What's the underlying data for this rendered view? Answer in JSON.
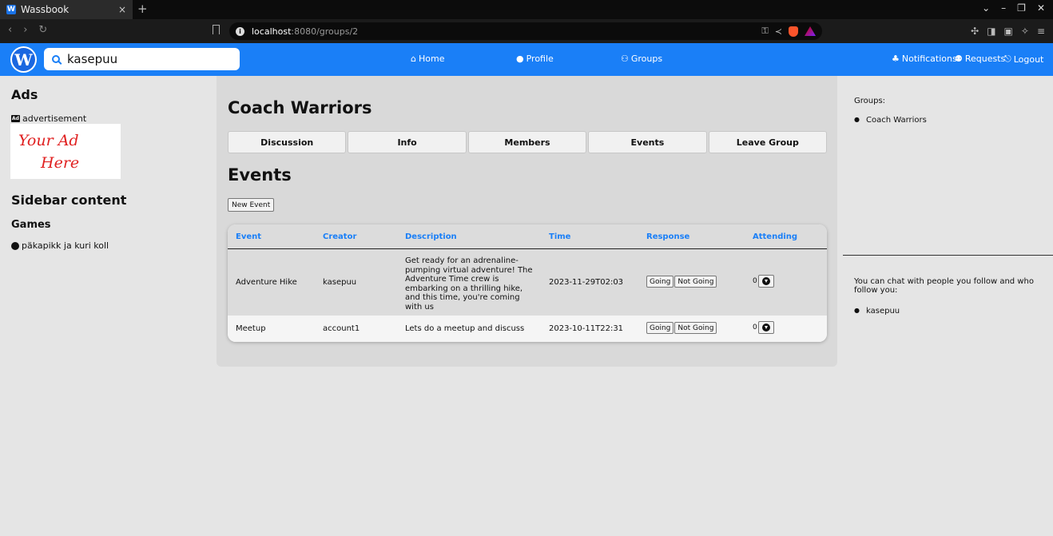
{
  "browser": {
    "tab_title": "Wassbook",
    "favicon": "W",
    "tab_close": "×",
    "new_tab": "+",
    "url_host": "localhost",
    "url_path": ":8080/groups/2",
    "nav_back": "‹",
    "nav_forward": "›",
    "reload": "↻"
  },
  "header": {
    "logo_letter": "W",
    "search_value": "kasepuu",
    "nav": {
      "home": "Home",
      "profile": "Profile",
      "groups": "Groups",
      "notifications": "Notifications",
      "requests": "Requests",
      "logout": "Logout"
    },
    "accent_color": "#1a7ff7"
  },
  "left_sidebar": {
    "ads_title": "Ads",
    "ad_badge": "Ad",
    "ad_label": "advertisement",
    "ad_text_line1": "Your Ad",
    "ad_text_line2": "Here",
    "sidebar_title": "Sidebar content",
    "games_title": "Games",
    "game_item": "päkapikk ja kuri koll"
  },
  "main": {
    "group_name": "Coach Warriors",
    "tabs": [
      {
        "label": "Discussion"
      },
      {
        "label": "Info"
      },
      {
        "label": "Members"
      },
      {
        "label": "Events"
      },
      {
        "label": "Leave Group"
      }
    ],
    "events_title": "Events",
    "new_event_label": "New Event",
    "table": {
      "headers": [
        "Event",
        "Creator",
        "Description",
        "Time",
        "Response",
        "Attending"
      ],
      "rows": [
        {
          "event": "Adventure Hike",
          "creator": "kasepuu",
          "description": "Get ready for an adrenaline-pumping virtual adventure! The Adventure Time crew is embarking on a thrilling hike, and this time, you're coming with us",
          "time": "2023-11-29T02:03",
          "going": "Going",
          "not_going": "Not Going",
          "attending": "0"
        },
        {
          "event": "Meetup",
          "creator": "account1",
          "description": "Lets do a meetup and discuss",
          "time": "2023-10-11T22:31",
          "going": "Going",
          "not_going": "Not Going",
          "attending": "0"
        }
      ]
    }
  },
  "right_sidebar": {
    "groups_label": "Groups:",
    "groups": [
      "Coach Warriors"
    ],
    "chat_text": "You can chat with people you follow and who follow you:",
    "followers": [
      "kasepuu"
    ]
  }
}
